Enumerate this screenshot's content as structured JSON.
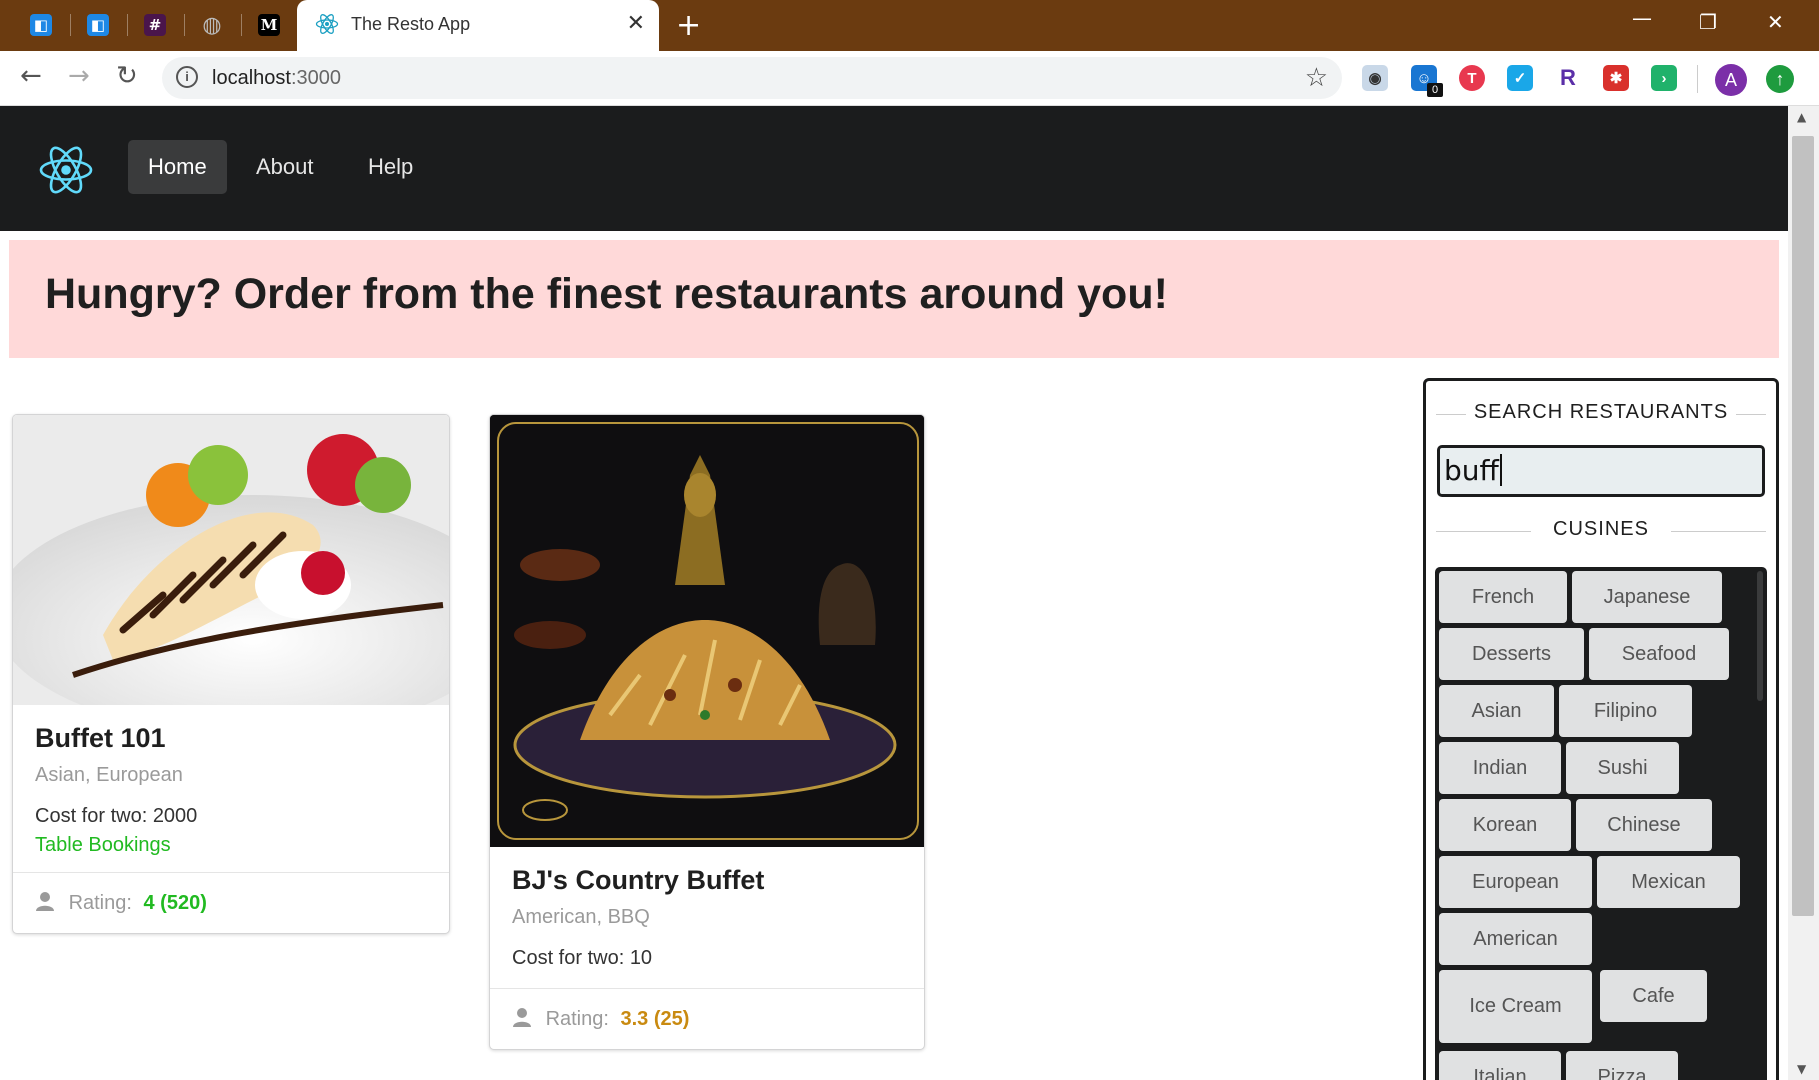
{
  "browser": {
    "active_tab_title": "The Resto App",
    "new_tab_symbol": "+",
    "close_tab_symbol": "✕",
    "url_host": "localhost",
    "url_port": ":3000",
    "extension_badge": "0",
    "profile_initial": "A",
    "colors": {
      "tabbar": "#6b3b10",
      "profile": "#7b2fa8",
      "update": "#1e9b3e"
    }
  },
  "nav": {
    "items": [
      {
        "label": "Home",
        "active": true
      },
      {
        "label": "About",
        "active": false
      },
      {
        "label": "Help",
        "active": false
      }
    ]
  },
  "banner": {
    "headline": "Hungry? Order from the finest restaurants around you!",
    "color": "#ffd9d9"
  },
  "restaurants": [
    {
      "name": "Buffet 101",
      "cuisines": "Asian, European",
      "cost": "Cost for two: 2000",
      "table_booking": "Table Bookings",
      "rating_label": "Rating:",
      "rating_value": "4 (520)",
      "rating_color": "#21ba21",
      "image_icon": "dessert-photo"
    },
    {
      "name": "BJ's Country Buffet",
      "cuisines": "American, BBQ",
      "cost": "Cost for two: 10",
      "rating_label": "Rating:",
      "rating_value": "3.3 (25)",
      "rating_color": "#c98a10",
      "image_icon": "biryani-photo"
    }
  ],
  "search": {
    "title": "SEARCH RESTAURANTS",
    "query": "buff",
    "cuisines_title": "CUSINES",
    "cuisines": [
      "French",
      "Japanese",
      "Desserts",
      "Seafood",
      "Asian",
      "Filipino",
      "Indian",
      "Sushi",
      "Korean",
      "Chinese",
      "European",
      "Mexican",
      "American",
      "Ice Cream",
      "Cafe",
      "Italian",
      "Pizza"
    ]
  }
}
